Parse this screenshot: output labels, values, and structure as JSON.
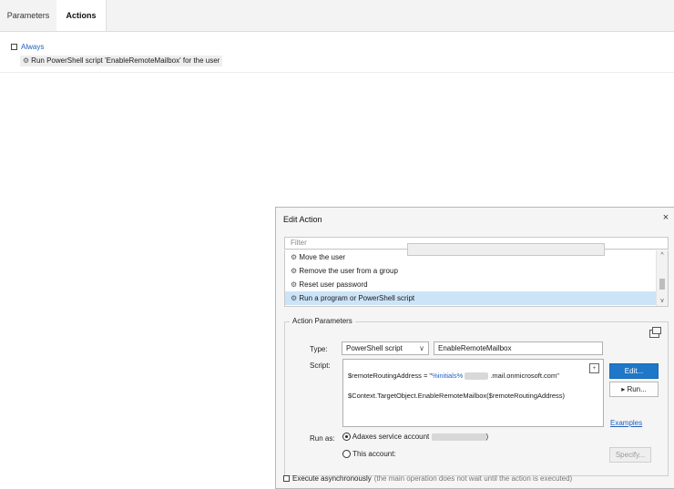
{
  "tabs": [
    {
      "label": "Parameters",
      "active": false
    },
    {
      "label": "Actions",
      "active": true
    }
  ],
  "condition": {
    "label": "Always"
  },
  "action_item": {
    "label": "Run PowerShell script 'EnableRemoteMailbox' for the user"
  },
  "dialog": {
    "title": "Edit Action",
    "close": "×",
    "filter_placeholder": "Filter",
    "list_items": [
      {
        "label": "Move the user",
        "selected": false
      },
      {
        "label": "Remove the user from a group",
        "selected": false
      },
      {
        "label": "Reset user password",
        "selected": false
      },
      {
        "label": "Run a program or PowerShell script",
        "selected": true
      }
    ],
    "group_label": "Action Parameters",
    "type_label": "Type:",
    "type_value": "PowerShell script",
    "script_name": "EnableRemoteMailbox",
    "script_label": "Script:",
    "script_line1_a": "$remoteRoutingAddress = \"",
    "script_line1_b": "%initials%",
    "script_line1_c": ".mail.onmicrosoft.com\"",
    "script_line2": "$Context.TargetObject.EnableRemoteMailbox($remoteRoutingAddress)",
    "edit_button": "Edit...",
    "run_button": "Run...",
    "examples_link": "Examples",
    "run_as_label": "Run as:",
    "service_account_label": "Adaxes service account",
    "service_account_close": ")",
    "this_account_label": "This account:",
    "specify_button": "Specify...",
    "exec_label": "Execute asynchronously",
    "exec_note": "(the main operation does not wait until the action is executed)"
  },
  "colors": {
    "accent": "#1f77c9",
    "link": "#1f5fbf",
    "selected_row": "#cce4f7"
  }
}
